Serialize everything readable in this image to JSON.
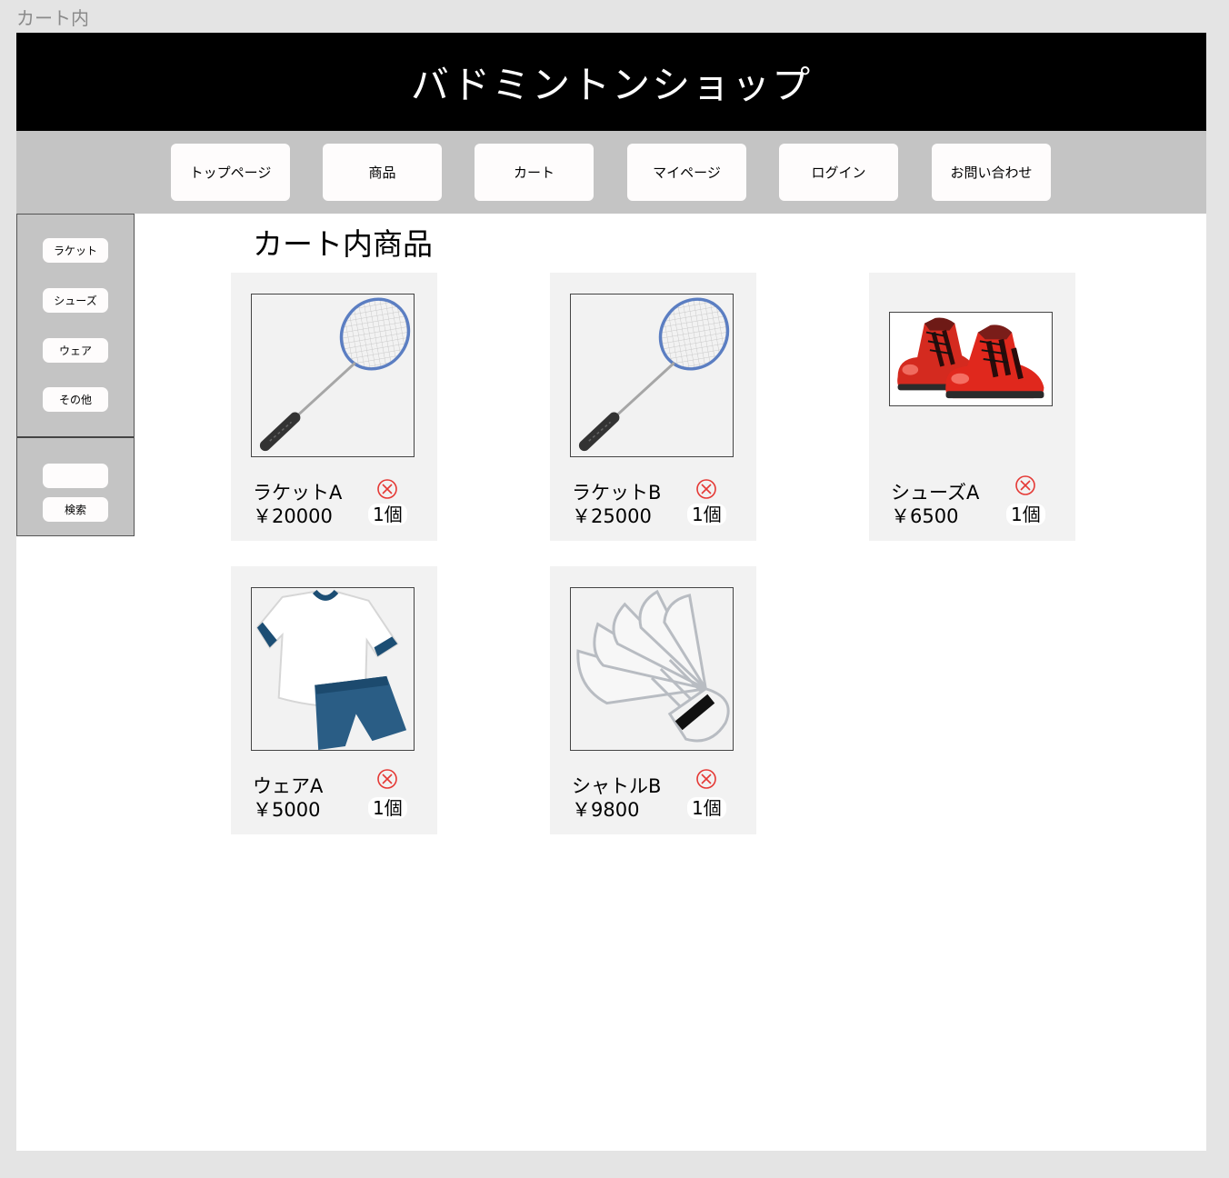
{
  "frame_label": "カート内",
  "header": {
    "title": "バドミントンショップ"
  },
  "nav": {
    "items": [
      {
        "label": "トップページ"
      },
      {
        "label": "商品"
      },
      {
        "label": "カート"
      },
      {
        "label": "マイページ"
      },
      {
        "label": "ログイン"
      },
      {
        "label": "お問い合わせ"
      }
    ]
  },
  "sidebar": {
    "categories": [
      {
        "label": "ラケット"
      },
      {
        "label": "シューズ"
      },
      {
        "label": "ウェア"
      },
      {
        "label": "その他"
      }
    ],
    "search": {
      "input_value": "",
      "button_label": "検索"
    }
  },
  "main": {
    "title": "カート内商品",
    "products": [
      {
        "name": "ラケットA",
        "price": "￥20000",
        "qty": "1個",
        "icon": "racket-image"
      },
      {
        "name": "ラケットB",
        "price": "￥25000",
        "qty": "1個",
        "icon": "racket-image"
      },
      {
        "name": "シューズA",
        "price": "￥6500",
        "qty": "1個",
        "icon": "shoes-image"
      },
      {
        "name": "ウェアA",
        "price": "￥5000",
        "qty": "1個",
        "icon": "wear-image"
      },
      {
        "name": "シャトルB",
        "price": "￥9800",
        "qty": "1個",
        "icon": "shuttlecock-image"
      }
    ]
  },
  "colors": {
    "header_bg": "#000000",
    "nav_bg": "#c4c4c4",
    "card_bg": "#f2f2f2",
    "remove_icon": "#e53935"
  }
}
